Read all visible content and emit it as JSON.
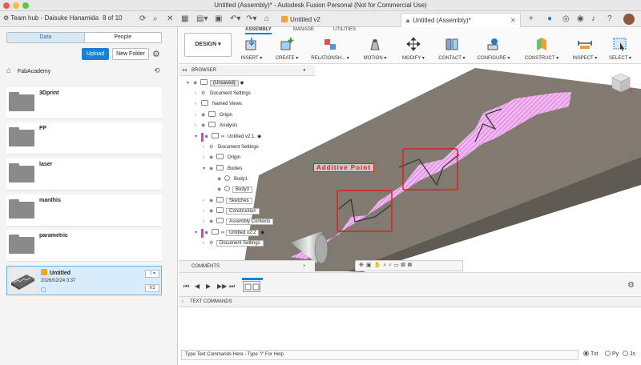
{
  "window": {
    "title": "Untitled (Assembly)* - Autodesk Fusion Personal (Not for Commercial Use)"
  },
  "appbar": {
    "hub": "Team hub - Daisuke Hanamida",
    "count": "8 of 10",
    "tabs": [
      {
        "label": "Untitled v2"
      },
      {
        "label": "Untitled (Assembly)*"
      }
    ]
  },
  "data_panel": {
    "tabs": [
      "Data",
      "People"
    ],
    "upload": "Upload",
    "new_folder": "New Folder",
    "breadcrumb": "FabAcademy",
    "folders": [
      "3Dprint",
      "FP",
      "laser",
      "manthis",
      "parametric"
    ],
    "file": {
      "name": "Untitled",
      "date": "2026/02/24 0:37",
      "version": "V2"
    }
  },
  "toolbar": {
    "design": "DESIGN",
    "workspace_tabs": [
      "ASSEMBLY",
      "MANAGE",
      "UTILITIES"
    ],
    "tools": [
      "INSERT",
      "CREATE",
      "RELATIONSH...",
      "MOTION",
      "MODIFY",
      "CONTACT",
      "CONFIGURE",
      "CONSTRUCT",
      "INSPECT",
      "SELECT"
    ]
  },
  "browser": {
    "title": "BROWSER",
    "nodes": [
      "(Unsaved)",
      "Document Settings",
      "Named Views",
      "Origin",
      "Analysis",
      "Untitled v2:1",
      "Document Settings",
      "Origin",
      "Bodies",
      "Body1",
      "Body3",
      "Sketches",
      "Construction",
      "Assembly Contexts",
      "Untitled v2:2",
      "Document Settings"
    ]
  },
  "annotation": "Additive Point",
  "comments": "COMMENTS",
  "text_commands": {
    "title": "TEXT COMMANDS",
    "placeholder": "Type Text Commands Here - Type '?' For Help",
    "modes": [
      "Txt",
      "Py",
      "Js"
    ]
  },
  "colors": {
    "accent": "#1b7fd6",
    "highlight": "#d63fd6",
    "annotation": "#e02020"
  }
}
